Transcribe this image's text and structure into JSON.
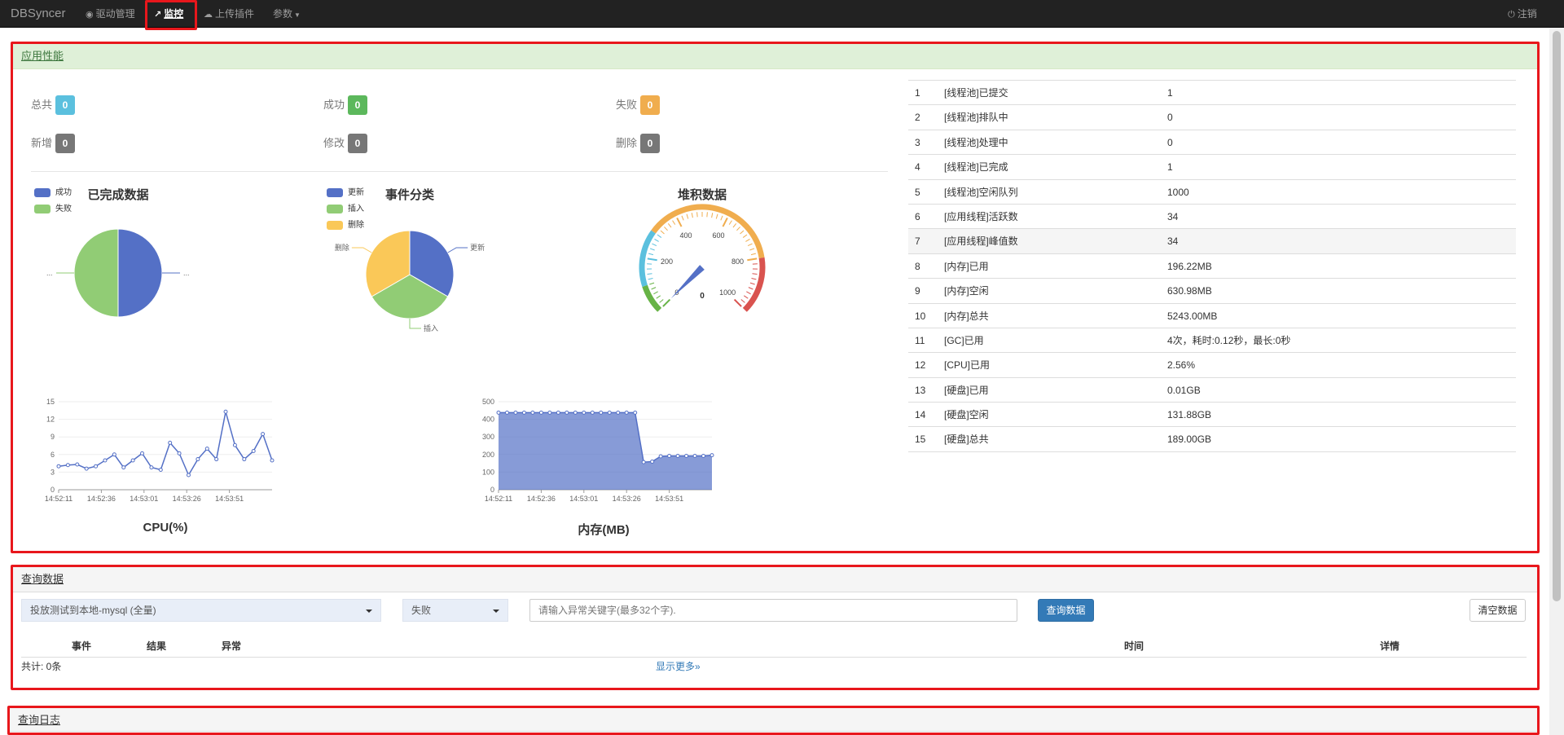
{
  "navbar": {
    "brand": "DBSyncer",
    "items": [
      {
        "label": "驱动管理",
        "icon": "dashboard-icon"
      },
      {
        "label": "监控",
        "icon": "line-chart-icon",
        "active": true
      },
      {
        "label": "上传插件",
        "icon": "cloud-upload-icon"
      },
      {
        "label": "参数",
        "icon": "caret-down-icon"
      }
    ],
    "logout": "注销",
    "logout_icon": "power-icon"
  },
  "performance": {
    "title": "应用性能",
    "stats": {
      "total_label": "总共",
      "total": "0",
      "success_label": "成功",
      "success": "0",
      "fail_label": "失败",
      "fail": "0",
      "insert_label": "新增",
      "insert": "0",
      "update_label": "修改",
      "update": "0",
      "delete_label": "删除",
      "delete": "0"
    }
  },
  "chart_data": [
    {
      "type": "pie",
      "title": "已完成数据",
      "legend": [
        "成功",
        "失败"
      ],
      "slices": [
        {
          "name": "成功",
          "value": 50
        },
        {
          "name": "失败",
          "value": 50
        }
      ],
      "slice_labels": [
        "...",
        "..."
      ],
      "colors": [
        "#5470c6",
        "#91cc75"
      ]
    },
    {
      "type": "pie",
      "title": "事件分类",
      "legend": [
        "更新",
        "插入",
        "删除"
      ],
      "slices": [
        {
          "name": "更新",
          "value": 33.3
        },
        {
          "name": "插入",
          "value": 33.3
        },
        {
          "name": "删除",
          "value": 33.3
        }
      ],
      "colors": [
        "#5470c6",
        "#91cc75",
        "#fac858"
      ]
    },
    {
      "type": "gauge",
      "title": "堆积数据",
      "value": 0,
      "value_label": "0",
      "min": 0,
      "max": 1000,
      "tick_labels": [
        "0",
        "200",
        "400",
        "600",
        "800",
        "1000"
      ]
    },
    {
      "type": "line",
      "title": "CPU(%)",
      "x_ticks": [
        "14:52:11",
        "14:52:36",
        "14:53:01",
        "14:53:26",
        "14:53:51"
      ],
      "y_ticks": [
        "0",
        "3",
        "6",
        "9",
        "12",
        "15"
      ],
      "ylim": [
        0,
        15
      ],
      "series": [
        {
          "values": [
            4.0,
            4.2,
            4.3,
            3.6,
            4.0,
            5.0,
            6.0,
            3.8,
            5.0,
            6.2,
            3.8,
            3.4,
            8.0,
            6.2,
            2.5,
            5.2,
            7.0,
            5.2,
            13.3,
            7.6,
            5.2,
            6.6,
            9.5,
            5.0
          ]
        }
      ]
    },
    {
      "type": "area",
      "title": "内存(MB)",
      "x_ticks": [
        "14:52:11",
        "14:52:36",
        "14:53:01",
        "14:53:26",
        "14:53:51"
      ],
      "y_ticks": [
        "0",
        "100",
        "200",
        "300",
        "400",
        "500"
      ],
      "ylim": [
        0,
        500
      ],
      "series": [
        {
          "values": [
            438,
            438,
            438,
            438,
            438,
            438,
            438,
            438,
            438,
            438,
            438,
            438,
            438,
            438,
            438,
            438,
            438,
            157,
            160,
            190,
            192,
            192,
            192,
            192,
            192,
            196
          ]
        }
      ]
    }
  ],
  "metrics": [
    {
      "no": "1",
      "name": "[线程池]已提交",
      "value": "1"
    },
    {
      "no": "2",
      "name": "[线程池]排队中",
      "value": "0"
    },
    {
      "no": "3",
      "name": "[线程池]处理中",
      "value": "0"
    },
    {
      "no": "4",
      "name": "[线程池]已完成",
      "value": "1"
    },
    {
      "no": "5",
      "name": "[线程池]空闲队列",
      "value": "1000"
    },
    {
      "no": "6",
      "name": "[应用线程]活跃数",
      "value": "34"
    },
    {
      "no": "7",
      "name": "[应用线程]峰值数",
      "value": "34"
    },
    {
      "no": "8",
      "name": "[内存]已用",
      "value": "196.22MB"
    },
    {
      "no": "9",
      "name": "[内存]空闲",
      "value": "630.98MB"
    },
    {
      "no": "10",
      "name": "[内存]总共",
      "value": "5243.00MB"
    },
    {
      "no": "11",
      "name": "[GC]已用",
      "value": "4次，耗时:0.12秒，最长:0秒"
    },
    {
      "no": "12",
      "name": "[CPU]已用",
      "value": "2.56%"
    },
    {
      "no": "13",
      "name": "[硬盘]已用",
      "value": "0.01GB"
    },
    {
      "no": "14",
      "name": "[硬盘]空闲",
      "value": "131.88GB"
    },
    {
      "no": "15",
      "name": "[硬盘]总共",
      "value": "189.00GB"
    }
  ],
  "query": {
    "title": "查询数据",
    "connector_select": "投放测试到本地-mysql (全量)",
    "status_select": "失败",
    "keyword_placeholder": "请输入异常关键字(最多32个字).",
    "search_button": "查询数据",
    "clear_button": "清空数据",
    "columns": {
      "event": "事件",
      "result": "结果",
      "error": "异常",
      "time": "时间",
      "detail": "详情"
    },
    "total": "共计: 0条",
    "show_more": "显示更多»"
  },
  "log": {
    "title": "查询日志"
  }
}
